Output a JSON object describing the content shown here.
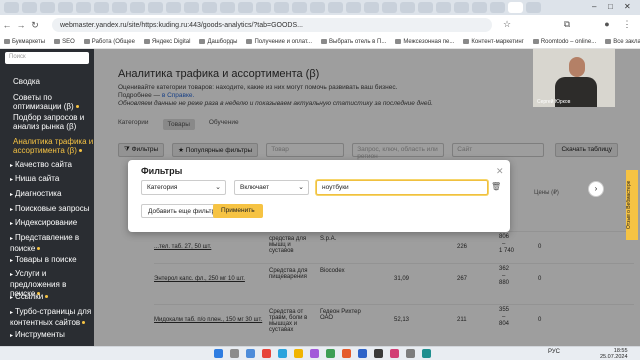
{
  "browser": {
    "tabs_count": 30,
    "url": "webmaster.yandex.ru/site/https:kuding.ru:443/goods-analytics/?tab=GOODS...",
    "window_controls": [
      "–",
      "□",
      "✕"
    ]
  },
  "bookmarks": [
    {
      "label": "Букмаркеты"
    },
    {
      "label": "SEO"
    },
    {
      "label": "Работа (Общее"
    },
    {
      "label": "Яндекс Digital"
    },
    {
      "label": "Дашборды"
    },
    {
      "label": "Получение и оплат..."
    },
    {
      "label": "Выбрать отель в П..."
    },
    {
      "label": "Межсезонная пе..."
    },
    {
      "label": "Контент-маркетинг"
    },
    {
      "label": "Roomtodo – online..."
    },
    {
      "label": "Все закладки"
    }
  ],
  "sidebar": {
    "search_placeholder": "Поиск",
    "items": [
      {
        "label": "Сводка",
        "active": false,
        "arrow": false,
        "dot": false
      },
      {
        "label": "Советы по оптимизации (β)",
        "active": false,
        "arrow": false,
        "dot": true
      },
      {
        "label": "Подбор запросов и анализ рынка (β)",
        "active": false,
        "arrow": false,
        "dot": false
      },
      {
        "label": "Аналитика трафика и ассортимента (β)",
        "active": true,
        "arrow": false,
        "dot": true
      },
      {
        "label": "Качество сайта",
        "active": false,
        "arrow": true,
        "dot": false
      },
      {
        "label": "Ниша сайта",
        "active": false,
        "arrow": true,
        "dot": false
      },
      {
        "label": "Диагностика",
        "active": false,
        "arrow": true,
        "dot": false
      },
      {
        "label": "Поисковые запросы",
        "active": false,
        "arrow": true,
        "dot": false
      },
      {
        "label": "Индексирование",
        "active": false,
        "arrow": true,
        "dot": false
      },
      {
        "label": "Представление в поиске",
        "active": false,
        "arrow": true,
        "dot": true
      },
      {
        "label": "Товары в поиске",
        "active": false,
        "arrow": true,
        "dot": false
      },
      {
        "label": "Услуги и предложения в поиске",
        "active": false,
        "arrow": true,
        "dot": true
      },
      {
        "label": "Ссылки",
        "active": false,
        "arrow": true,
        "dot": true
      },
      {
        "label": "Турбо-страницы для контентных сайтов",
        "active": false,
        "arrow": true,
        "dot": true
      },
      {
        "label": "Инструменты",
        "active": false,
        "arrow": true,
        "dot": false
      }
    ]
  },
  "main": {
    "title": "Аналитика трафика и ассортимента (β)",
    "desc1": "Оценивайте категории товаров: находите, какие из них могут помочь развивать ваш бизнес.",
    "desc2_prefix": "Подробнее — ",
    "desc2_link": "в Справке.",
    "desc3": "Обновляем данные не реже раза в неделю и показываем актуальную статистику за последние дней.",
    "tabs": [
      "Категории",
      "Товары",
      "Обучение"
    ],
    "active_tab": "Товары",
    "filters_btn": "Фильтры",
    "popular_filters_btn": "Популярные фильтры",
    "search_product_placeholder": "Товар",
    "search_query_placeholder": "Запрос, ключ, область или регион",
    "search_site_placeholder": "Сайт",
    "download_btn": "Скачать таблицу",
    "price_header": "Цены (₽)",
    "rows": [
      {
        "name": "...тел. таб. 27, 50 шт.",
        "category": "средства для мышц и суставов",
        "maker": "S.p.A.",
        "value": "",
        "count": "226",
        "price_a": "806",
        "price_sep": "–",
        "price_b": "1 740",
        "tail": "0"
      },
      {
        "name": "Энтерол капс. фл., 250 мг 10 шт.",
        "category": "Средства для пищеварения",
        "maker": "Biocodex",
        "value": "31,09",
        "count": "267",
        "price_a": "362",
        "price_sep": "–",
        "price_b": "880",
        "tail": "0"
      },
      {
        "name": "Мидокалм таб. п/о плен., 150 мг 30 шт.",
        "category": "Средства от травм, боли в мышцах и суставах",
        "maker": "Гедеон Рихтер ОАО",
        "value": "52,13",
        "count": "211",
        "price_a": "355",
        "price_sep": "–",
        "price_b": "804",
        "tail": "0"
      }
    ]
  },
  "modal": {
    "title": "Фильтры",
    "close": "✕",
    "field_select": "Категория",
    "operator_select": "Включает",
    "value_input": "ноутбуки",
    "add_filter_btn": "Добавить еще фильтр",
    "apply_btn": "Применить"
  },
  "webcam": {
    "label": "Сергей Юрков"
  },
  "sidetab": {
    "label": "Отзыв о Вебмастере"
  },
  "taskbar": {
    "lang": "РУС",
    "time": "18:55",
    "date": "25.07.2024"
  },
  "colors": {
    "accent": "#f6c343",
    "sidebar_bg": "#2a2d32"
  }
}
